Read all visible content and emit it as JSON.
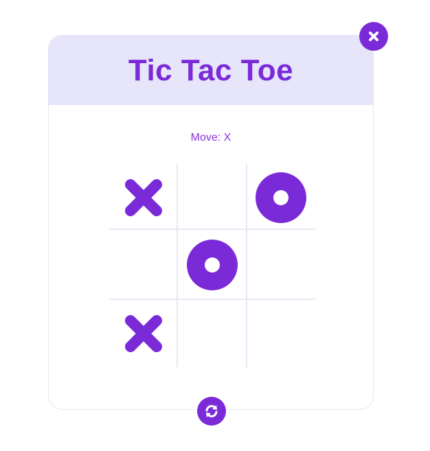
{
  "game": {
    "title": "Tic Tac Toe",
    "status": "Move: X"
  },
  "board": {
    "cells": [
      "X",
      "",
      "O",
      "",
      "O",
      "",
      "X",
      "",
      ""
    ]
  },
  "colors": {
    "accent": "#7b2ad8",
    "header_bg": "#e6e5fa",
    "grid_line": "#e8e6f5"
  },
  "icons": {
    "close": "close-icon",
    "reset": "refresh-icon",
    "x_mark": "x-mark-icon",
    "o_mark": "o-mark-icon"
  }
}
